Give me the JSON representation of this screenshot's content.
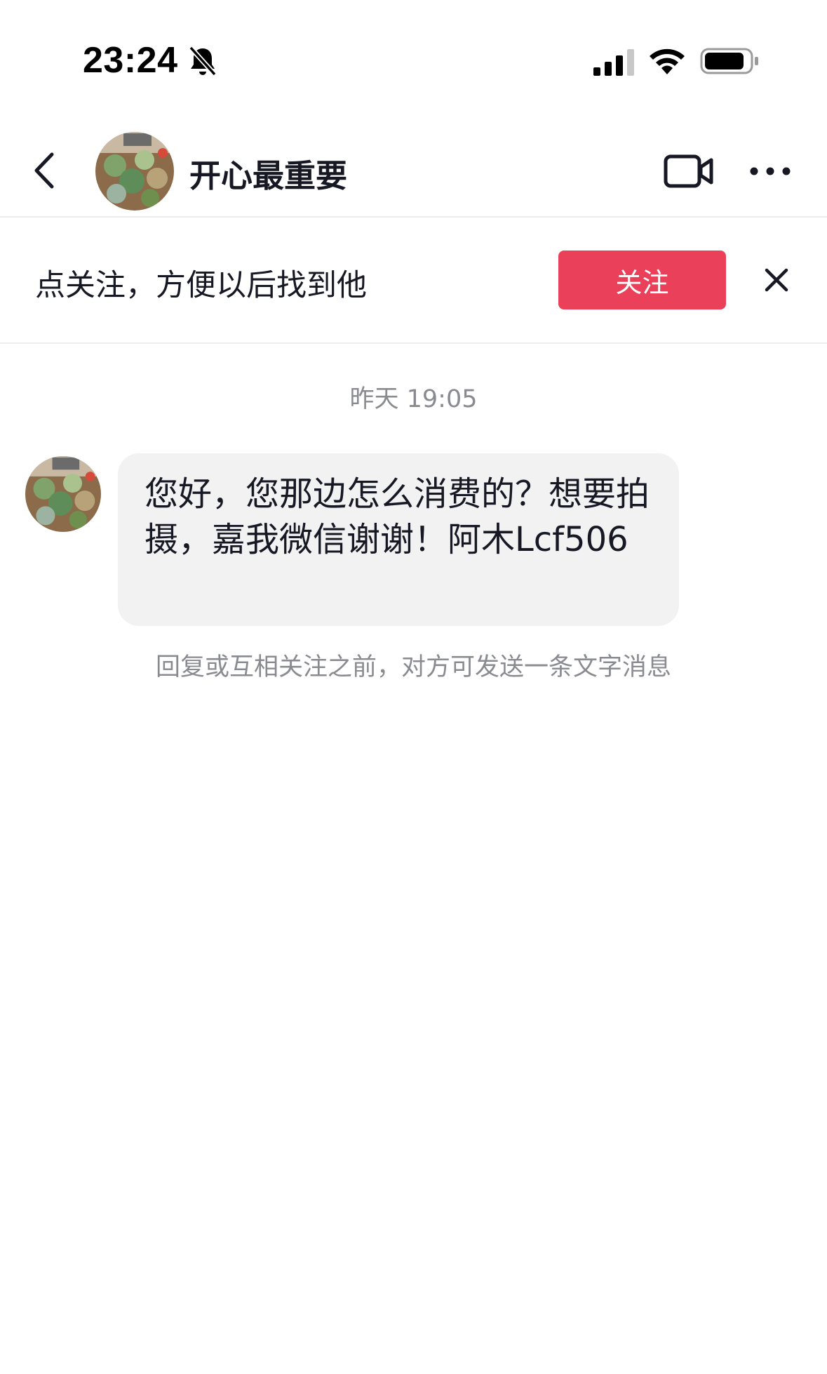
{
  "status_bar": {
    "time": "23:24",
    "icons": [
      "bell-slash-icon",
      "cellular-signal-icon",
      "wifi-icon",
      "battery-icon"
    ]
  },
  "header": {
    "name": "开心最重要",
    "icons": [
      "back-chevron-icon",
      "video-call-icon",
      "more-icon"
    ]
  },
  "follow_banner": {
    "prompt": "点关注，方便以后找到他",
    "button_label": "关注",
    "close_icon": "close-icon"
  },
  "chat": {
    "timestamp": "昨天 19:05",
    "messages": [
      {
        "from": "other",
        "text": "您好，您那边怎么消费的？想要拍摄，嘉我微信谢谢！阿木Lcf506"
      }
    ],
    "notice": "回复或互相关注之前，对方可发送一条文字消息"
  },
  "colors": {
    "accent": "#ea405a",
    "bubble": "#f2f2f3",
    "muted_text": "#8a8b91",
    "primary_text": "#161823"
  }
}
